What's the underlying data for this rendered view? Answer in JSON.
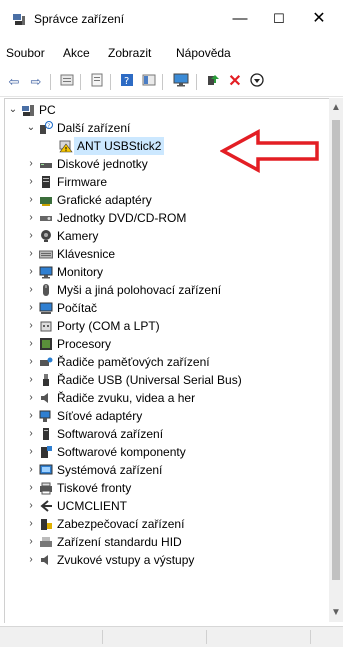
{
  "window": {
    "title": "Správce zařízení",
    "controls": {
      "minimize": "—",
      "maximize": "☐",
      "close": "✕"
    }
  },
  "menu": [
    "Soubor",
    "Akce",
    "Zobrazit",
    "Nápověda"
  ],
  "toolbar": {
    "icons": [
      "back-icon",
      "forward-icon",
      "properties-icon",
      "driver-icon",
      "help-icon",
      "view-icon",
      "monitor-icon",
      "update-driver-icon",
      "uninstall-icon",
      "scan-icon"
    ]
  },
  "tree": {
    "root": "PC",
    "selected_category": "Další zařízení",
    "selected_device": "ANT USBStick2",
    "categories": [
      "Diskové jednotky",
      "Firmware",
      "Grafické adaptéry",
      "Jednotky DVD/CD-ROM",
      "Kamery",
      "Klávesnice",
      "Monitory",
      "Myši a jiná polohovací zařízení",
      "Počítač",
      "Porty (COM a LPT)",
      "Procesory",
      "Řadiče paměťových zařízení",
      "Řadiče USB (Universal Serial Bus)",
      "Řadiče zvuku, videa a her",
      "Síťové adaptéry",
      "Softwarová zařízení",
      "Softwarové komponenty",
      "Systémová zařízení",
      "Tiskové fronty",
      "UCMCLIENT",
      "Zabezpečovací zařízení",
      "Zařízení standardu HID",
      "Zvukové vstupy a výstupy"
    ]
  },
  "colors": {
    "arrow": "#e31e24",
    "selection": "#cce8ff"
  }
}
